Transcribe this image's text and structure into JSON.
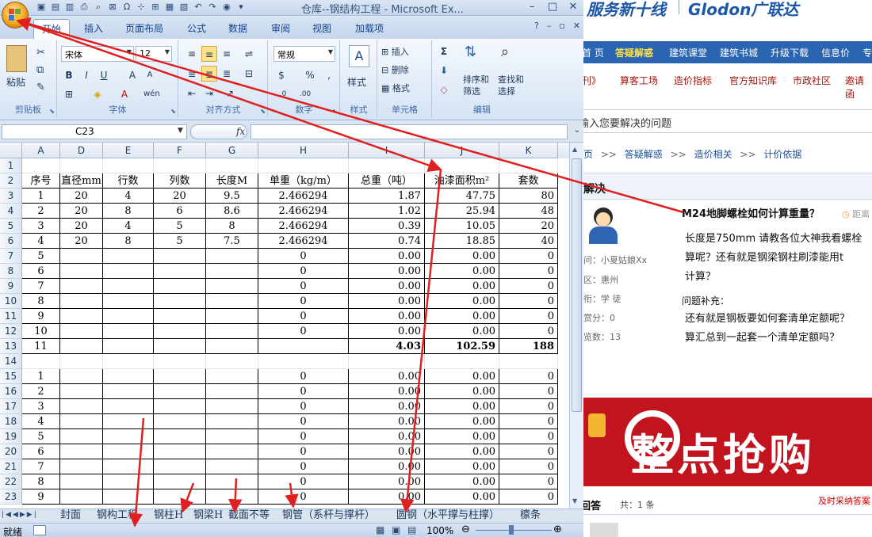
{
  "excel": {
    "title": "仓库--钢结构工程 - Microsoft Ex...",
    "tabs": [
      "开始",
      "插入",
      "页面布局",
      "公式",
      "数据",
      "审阅",
      "视图",
      "加载项"
    ],
    "ribbon": {
      "clipboard": {
        "label": "剪贴板",
        "paste": "粘贴"
      },
      "font": {
        "label": "字体",
        "name": "宋体",
        "size": "12"
      },
      "alignment": {
        "label": "对齐方式"
      },
      "number": {
        "label": "数字",
        "format": "常规"
      },
      "styles": {
        "label": "样式"
      },
      "cells": {
        "label": "单元格",
        "insert": "插入",
        "delete": "删除",
        "format": "格式"
      },
      "editing": {
        "label": "编辑",
        "sort": "排序和\n筛选",
        "find": "查找和\n选择"
      }
    },
    "name_box": "C23",
    "fx": "fx",
    "columns": [
      "A",
      "D",
      "E",
      "F",
      "G",
      "H",
      "I",
      "J",
      "K"
    ],
    "rows": [
      {
        "n": "1",
        "cells": [
          "",
          "",
          "",
          "",
          "",
          "",
          "",
          "",
          ""
        ]
      },
      {
        "n": "2",
        "cells": [
          "序号",
          "直径mm",
          "行数",
          "列数",
          "长度M",
          "单重（kg/m）",
          "总重（吨）",
          "油漆面积m²",
          "套数"
        ]
      },
      {
        "n": "3",
        "cells": [
          "1",
          "20",
          "4",
          "20",
          "9.5",
          "2.466294",
          "1.87",
          "47.75",
          "80"
        ]
      },
      {
        "n": "4",
        "cells": [
          "2",
          "20",
          "8",
          "6",
          "8.6",
          "2.466294",
          "1.02",
          "25.94",
          "48"
        ]
      },
      {
        "n": "5",
        "cells": [
          "3",
          "20",
          "4",
          "5",
          "8",
          "2.466294",
          "0.39",
          "10.05",
          "20"
        ]
      },
      {
        "n": "6",
        "cells": [
          "4",
          "20",
          "8",
          "5",
          "7.5",
          "2.466294",
          "0.74",
          "18.85",
          "40"
        ]
      },
      {
        "n": "7",
        "cells": [
          "5",
          "",
          "",
          "",
          "",
          "0",
          "0.00",
          "0.00",
          "0"
        ]
      },
      {
        "n": "8",
        "cells": [
          "6",
          "",
          "",
          "",
          "",
          "0",
          "0.00",
          "0.00",
          "0"
        ]
      },
      {
        "n": "9",
        "cells": [
          "7",
          "",
          "",
          "",
          "",
          "0",
          "0.00",
          "0.00",
          "0"
        ]
      },
      {
        "n": "10",
        "cells": [
          "8",
          "",
          "",
          "",
          "",
          "0",
          "0.00",
          "0.00",
          "0"
        ]
      },
      {
        "n": "11",
        "cells": [
          "9",
          "",
          "",
          "",
          "",
          "0",
          "0.00",
          "0.00",
          "0"
        ]
      },
      {
        "n": "12",
        "cells": [
          "10",
          "",
          "",
          "",
          "",
          "0",
          "0.00",
          "0.00",
          "0"
        ]
      },
      {
        "n": "13",
        "cells": [
          "11",
          "",
          "",
          "",
          "",
          "",
          "4.03",
          "102.59",
          "188"
        ]
      },
      {
        "n": "14",
        "cells": [
          "",
          "",
          "",
          "",
          "",
          "",
          "",
          "",
          ""
        ]
      },
      {
        "n": "15",
        "cells": [
          "1",
          "",
          "",
          "",
          "",
          "0",
          "0.00",
          "0.00",
          "0"
        ]
      },
      {
        "n": "16",
        "cells": [
          "2",
          "",
          "",
          "",
          "",
          "0",
          "0.00",
          "0.00",
          "0"
        ]
      },
      {
        "n": "17",
        "cells": [
          "3",
          "",
          "",
          "",
          "",
          "0",
          "0.00",
          "0.00",
          "0"
        ]
      },
      {
        "n": "18",
        "cells": [
          "4",
          "",
          "",
          "",
          "",
          "0",
          "0.00",
          "0.00",
          "0"
        ]
      },
      {
        "n": "19",
        "cells": [
          "5",
          "",
          "",
          "",
          "",
          "0",
          "0.00",
          "0.00",
          "0"
        ]
      },
      {
        "n": "20",
        "cells": [
          "6",
          "",
          "",
          "",
          "",
          "0",
          "0.00",
          "0.00",
          "0"
        ]
      },
      {
        "n": "21",
        "cells": [
          "7",
          "",
          "",
          "",
          "",
          "0",
          "0.00",
          "0.00",
          "0"
        ]
      },
      {
        "n": "22",
        "cells": [
          "8",
          "",
          "",
          "",
          "",
          "0",
          "0.00",
          "0.00",
          "0"
        ]
      },
      {
        "n": "23",
        "cells": [
          "9",
          "",
          "",
          "",
          "",
          "0",
          "0.00",
          "0.00",
          "0"
        ]
      }
    ],
    "sheets": [
      "封面",
      "钢构工程",
      "钢柱H",
      "钢梁H",
      "截面不等",
      "钢管（系杆与撑杆）",
      "圆钢（水平撑与柱撑）",
      "檩条"
    ],
    "status": "就绪",
    "zoom": "100%"
  },
  "web": {
    "logo_left": "服务新十线",
    "logo_right": "Glodon广联达",
    "nav": [
      "首 页",
      "答疑解惑",
      "建筑课堂",
      "建筑书城",
      "升级下载",
      "信息价",
      "专"
    ],
    "subnav": [
      "刊》",
      "算客工场",
      "造价指标",
      "官方知识库",
      "市政社区",
      "邀请函"
    ],
    "search_placeholder": "输入您要解决的问题",
    "breadcrumb": [
      "页",
      ">>",
      "答疑解惑",
      ">>",
      "造价相关",
      ">>",
      "计价依据"
    ],
    "solved_label": "未解决",
    "question_title": "M24地脚螺栓如何计算重量？",
    "distance": "距离",
    "meta": [
      "问：小夏姑娘Xx",
      "区：惠州",
      "衔：学 徒",
      "赏分：0",
      "览数：13"
    ],
    "body": [
      "长度是750mm 请教各位大神我看螺栓",
      "算呢？还有就是钢梁钢柱刷漆能用t",
      "计算？"
    ],
    "supplement_label": "问题补充：",
    "supplement": [
      "还有就是钢板要如何套清单定额呢？",
      "算汇总到一起套一个清单定额吗？"
    ],
    "banner": "整点抢购",
    "answers_label": "回答",
    "answers_count": "共：1 条",
    "adopt": "及时采纳答案"
  }
}
